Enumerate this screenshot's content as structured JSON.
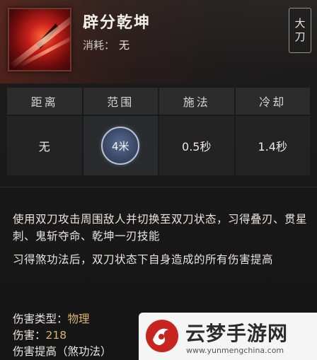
{
  "skill": {
    "name": "辟分乾坤",
    "cost_label": "消耗：",
    "cost_value": "无",
    "weapon_line1": "大",
    "weapon_line2": "刀"
  },
  "stats": {
    "headers": [
      "距离",
      "范围",
      "施法",
      "冷却"
    ],
    "values": [
      "无",
      "4米",
      "0.5秒",
      "1.4秒"
    ]
  },
  "description": {
    "p1": "使用双刀攻击周围敌人并切换至双刀状态，习得叠刃、贯星刺、鬼斩夺命、乾坤一刃技能",
    "p2": "习得煞功法后，双刀状态下自身造成的所有伤害提高"
  },
  "attributes": {
    "type_label": "伤害类型：",
    "type_value": "物理",
    "damage_label": "伤害：",
    "damage_value": "218",
    "boost_label": "伤害提高（煞功法）"
  },
  "watermark": {
    "title": "云梦手游网",
    "url": "www.yunmengchina.com"
  },
  "colors": {
    "accent_gold": "#d7b470",
    "range_circle": "#3a4866",
    "icon_red": "#c8201a"
  }
}
